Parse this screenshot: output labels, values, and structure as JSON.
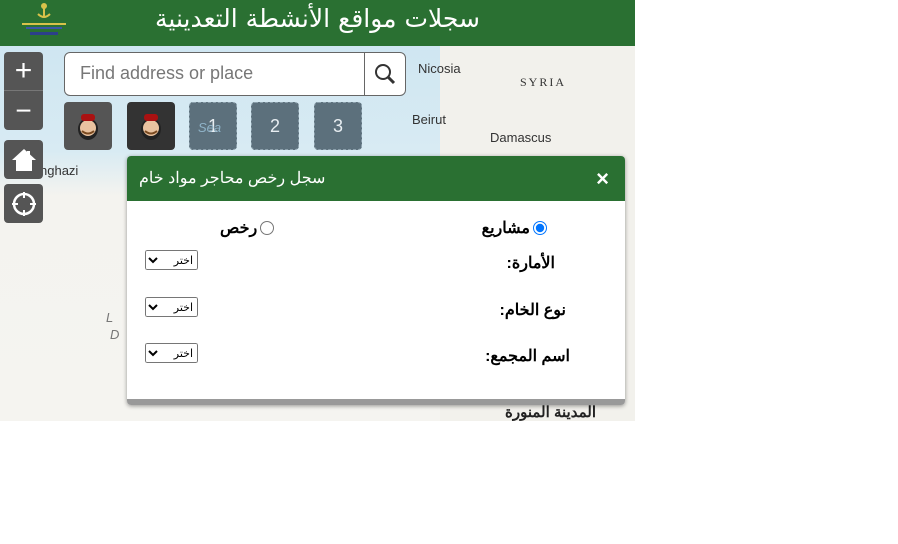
{
  "header": {
    "title": "سجلات مواقع الأنشطة التعدينية"
  },
  "map": {
    "labels": {
      "nicosia": "Nicosia",
      "syria": "SYRIA",
      "beirut": "Beirut",
      "damascus": "Damascus",
      "benghazi": "nghazi",
      "sea": "Sea",
      "l": "L",
      "d": "D",
      "madinah": "المدينة المنورة"
    }
  },
  "controls": {
    "zoom_in": "+",
    "zoom_out": "−"
  },
  "search": {
    "placeholder": "Find address or place"
  },
  "toolbar": {
    "numbers": [
      "1",
      "2",
      "3"
    ]
  },
  "panel": {
    "title": "سجل رخص محاجر مواد خام",
    "close": "×",
    "radios": {
      "projects": "مشاريع",
      "licenses": "رخص",
      "selected": "projects"
    },
    "fields": [
      {
        "label": "الأمارة:",
        "value": "اختر"
      },
      {
        "label": "نوع الخام:",
        "value": "اختر"
      },
      {
        "label": "اسم المجمع:",
        "value": "اختر"
      }
    ]
  }
}
